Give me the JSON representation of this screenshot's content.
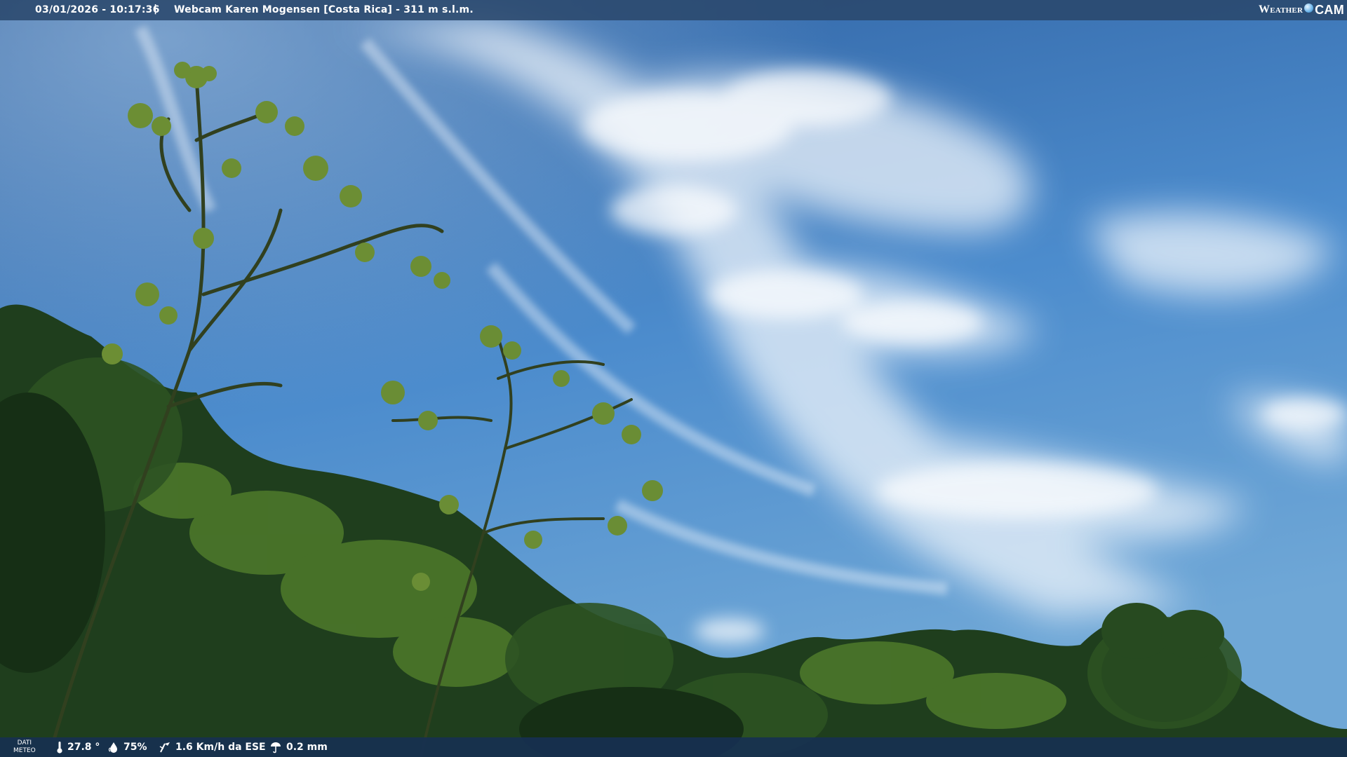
{
  "overlay": {
    "timestamp": "03/01/2026 - 10:17:36",
    "separator": "|",
    "location": "Webcam Karen Mogensen [Costa Rica] - 311 m s.l.m.",
    "logo": {
      "weather": "Weather",
      "cam": "CAM"
    }
  },
  "weather_bar": {
    "label_line1": "DATI",
    "label_line2": "METEO",
    "temperature": "27.8 °",
    "humidity": "75%",
    "wind": "1.6 Km/h da ESE",
    "rain": "0.2 mm",
    "icons": [
      "thermometer-icon",
      "humidity-drop-icon",
      "wind-icon",
      "rain-icon"
    ]
  },
  "colors": {
    "sky_top": "#2f61a4",
    "sky_mid": "#4a87c9",
    "bar": "#1e3c64",
    "foliage": "#1f3e1d"
  }
}
